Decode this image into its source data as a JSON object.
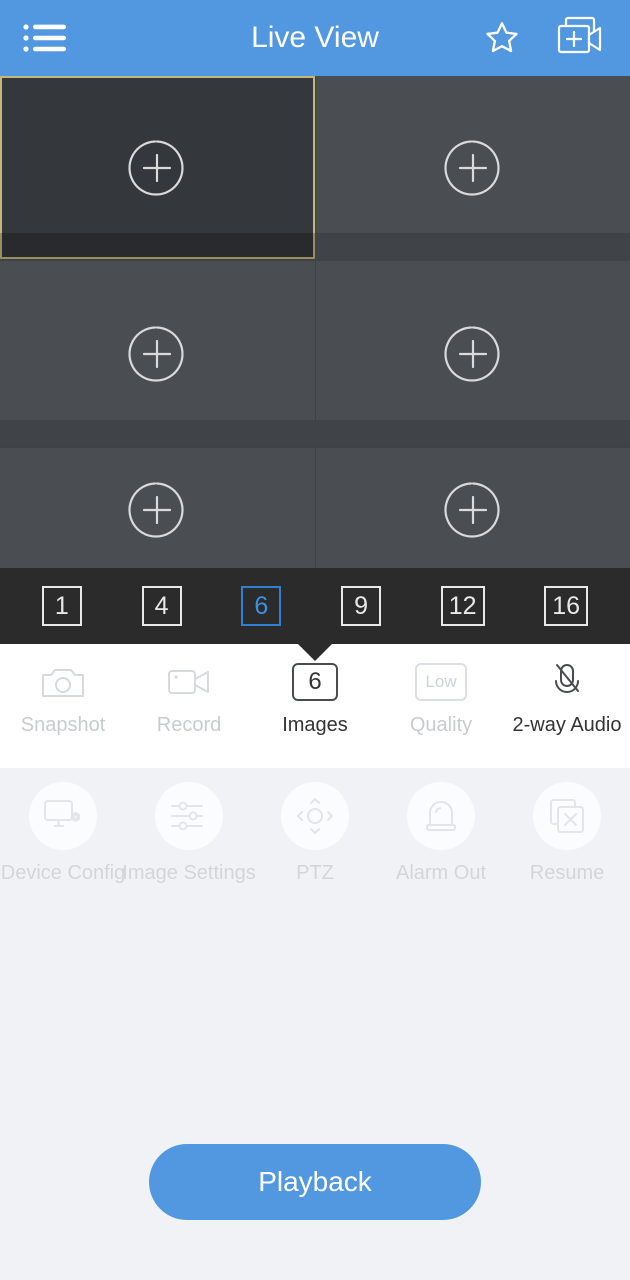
{
  "header": {
    "title": "Live View",
    "menu_icon": "list-menu-icon",
    "favorite_icon": "star-outline-icon",
    "add_device_icon": "add-camera-icon"
  },
  "grid": {
    "add_icon": "add-channel-icon",
    "cells": [
      {
        "index": 1,
        "selected": true,
        "label": ""
      },
      {
        "index": 2,
        "selected": false,
        "label": ""
      },
      {
        "index": 3,
        "selected": false,
        "label": ""
      },
      {
        "index": 4,
        "selected": false,
        "label": ""
      },
      {
        "index": 5,
        "selected": false,
        "label": ""
      },
      {
        "index": 6,
        "selected": false,
        "label": ""
      }
    ]
  },
  "layout_selector": {
    "selected": "6",
    "options": [
      {
        "label": "1",
        "active": false
      },
      {
        "label": "4",
        "active": false
      },
      {
        "label": "6",
        "active": true
      },
      {
        "label": "9",
        "active": false
      },
      {
        "label": "12",
        "active": false
      },
      {
        "label": "16",
        "active": false
      }
    ]
  },
  "tools_primary": [
    {
      "label": "Snapshot",
      "icon": "camera-icon",
      "enabled": false
    },
    {
      "label": "Record",
      "icon": "video-camera-icon",
      "enabled": false
    },
    {
      "label": "Images",
      "icon": "images-count-badge",
      "badge": "6",
      "enabled": true
    },
    {
      "label": "Quality",
      "icon": "quality-badge",
      "badge": "Low",
      "enabled": false
    },
    {
      "label": "2-way Audio",
      "icon": "mic-muted-icon",
      "enabled": true
    }
  ],
  "tools_secondary": [
    {
      "label": "Device Config",
      "icon": "monitor-gear-icon",
      "enabled": false
    },
    {
      "label": "Image Settings",
      "icon": "sliders-icon",
      "enabled": false
    },
    {
      "label": "PTZ",
      "icon": "ptz-direction-icon",
      "enabled": false
    },
    {
      "label": "Alarm Out",
      "icon": "siren-icon",
      "enabled": false
    },
    {
      "label": "Resume",
      "icon": "close-windows-icon",
      "enabled": false
    }
  ],
  "playback": {
    "label": "Playback"
  },
  "colors": {
    "accent_blue": "#5298e0",
    "selected_cell_border": "#c3b77a",
    "layout_bar_bg": "#2b2b2b",
    "page_bg": "#f0f2f6",
    "cell_bg": "#4a4e53",
    "cell_selected_bg": "#34373b"
  }
}
